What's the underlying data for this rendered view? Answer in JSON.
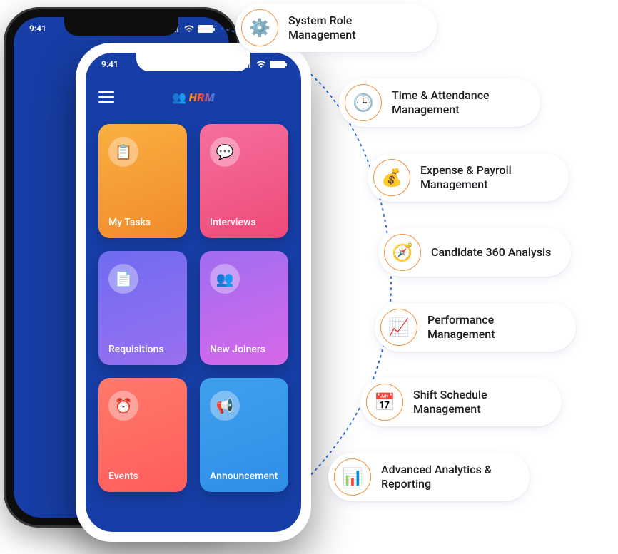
{
  "status_time": "9:41",
  "app_logo_text": "HRM",
  "tiles": [
    {
      "label": "My Tasks",
      "icon": "📋"
    },
    {
      "label": "Interviews",
      "icon": "💬"
    },
    {
      "label": "Requisitions",
      "icon": "📄"
    },
    {
      "label": "New Joiners",
      "icon": "👥"
    },
    {
      "label": "Events",
      "icon": "⏰"
    },
    {
      "label": "Announcement",
      "icon": "📢"
    }
  ],
  "features": [
    {
      "label": "System Role Management",
      "icon": "⚙️"
    },
    {
      "label": "Time & Attendance Management",
      "icon": "🕒"
    },
    {
      "label": "Expense & Payroll Management",
      "icon": "💰"
    },
    {
      "label": "Candidate 360 Analysis",
      "icon": "🧭"
    },
    {
      "label": "Performance Management",
      "icon": "📈"
    },
    {
      "label": "Shift Schedule Management",
      "icon": "📅"
    },
    {
      "label": "Advanced Analytics & Reporting",
      "icon": "📊"
    }
  ]
}
